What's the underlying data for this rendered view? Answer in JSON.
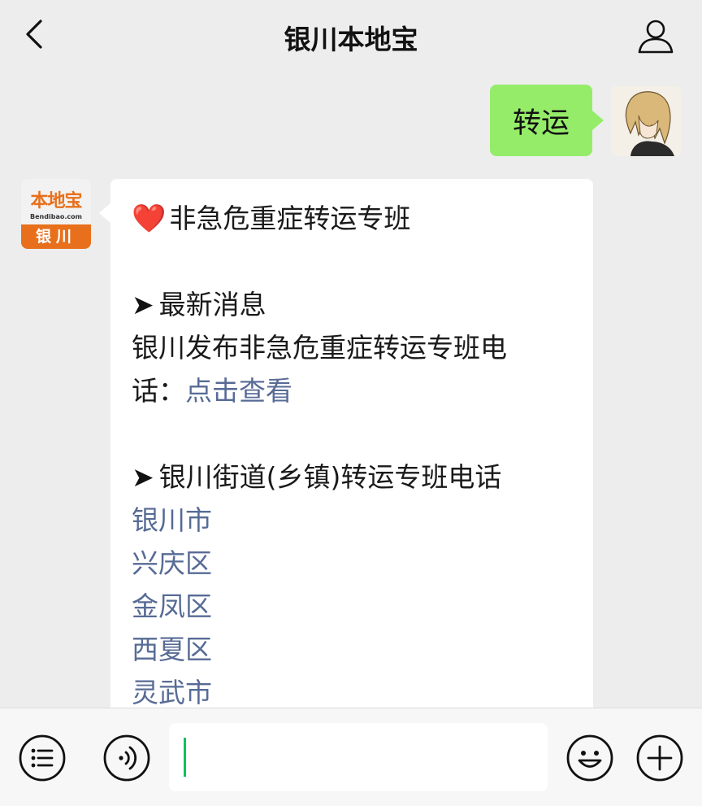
{
  "header": {
    "title": "银川本地宝",
    "back_icon": "chevron-left-icon",
    "profile_icon": "person-icon"
  },
  "messages": {
    "outgoing": {
      "text": "转运",
      "bubble_color": "#95ec69"
    },
    "account_avatar": {
      "logo_main": "本地宝",
      "logo_domain": "Bendibao.com",
      "logo_city": "银川",
      "brand_color": "#e8701c"
    },
    "incoming": {
      "heart_icon": "❤️",
      "title": "非急危重症转运专班",
      "section1_arrow": "➤",
      "section1_heading": "最新消息",
      "news_line1": "银川发布非急危重症转运专班电",
      "news_line2_prefix": "话：",
      "news_link": "点击查看",
      "section2_arrow": "➤",
      "section2_heading": "银川街道(乡镇)转运专班电话",
      "district_links": [
        "银川市",
        "兴庆区",
        "金凤区",
        "西夏区",
        "灵武市"
      ],
      "link_color": "#576b95"
    }
  },
  "input_bar": {
    "menu_icon": "list-menu-icon",
    "voice_icon": "voice-icon",
    "input_value": "",
    "emoji_icon": "emoji-icon",
    "add_icon": "plus-icon",
    "caret_color": "#07c160"
  }
}
